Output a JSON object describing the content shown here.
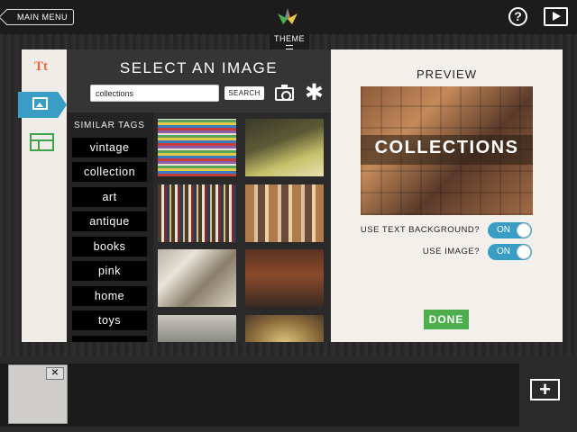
{
  "header": {
    "main_menu_label": "MAIN MENU",
    "theme_label": "THEME"
  },
  "tools": {
    "text_tool_label": "Tt"
  },
  "select_image": {
    "title": "SELECT AN IMAGE",
    "search_value": "collections",
    "search_button_label": "SEARCH",
    "similar_tags_label": "SIMILAR TAGS",
    "tags": [
      "vintage",
      "collection",
      "art",
      "antique",
      "books",
      "pink",
      "home",
      "toys"
    ]
  },
  "preview": {
    "title": "PREVIEW",
    "caption": "COLLECTIONS",
    "options": [
      {
        "label": "USE TEXT BACKGROUND?",
        "state": "ON"
      },
      {
        "label": "USE IMAGE?",
        "state": "ON"
      }
    ],
    "done_label": "DONE"
  },
  "pages": {
    "close_glyph": "✕",
    "add_glyph": "+"
  },
  "colors": {
    "accent_blue": "#3a9dc5",
    "accent_green": "#4cae4c",
    "text_tool_orange": "#e96a3e"
  }
}
